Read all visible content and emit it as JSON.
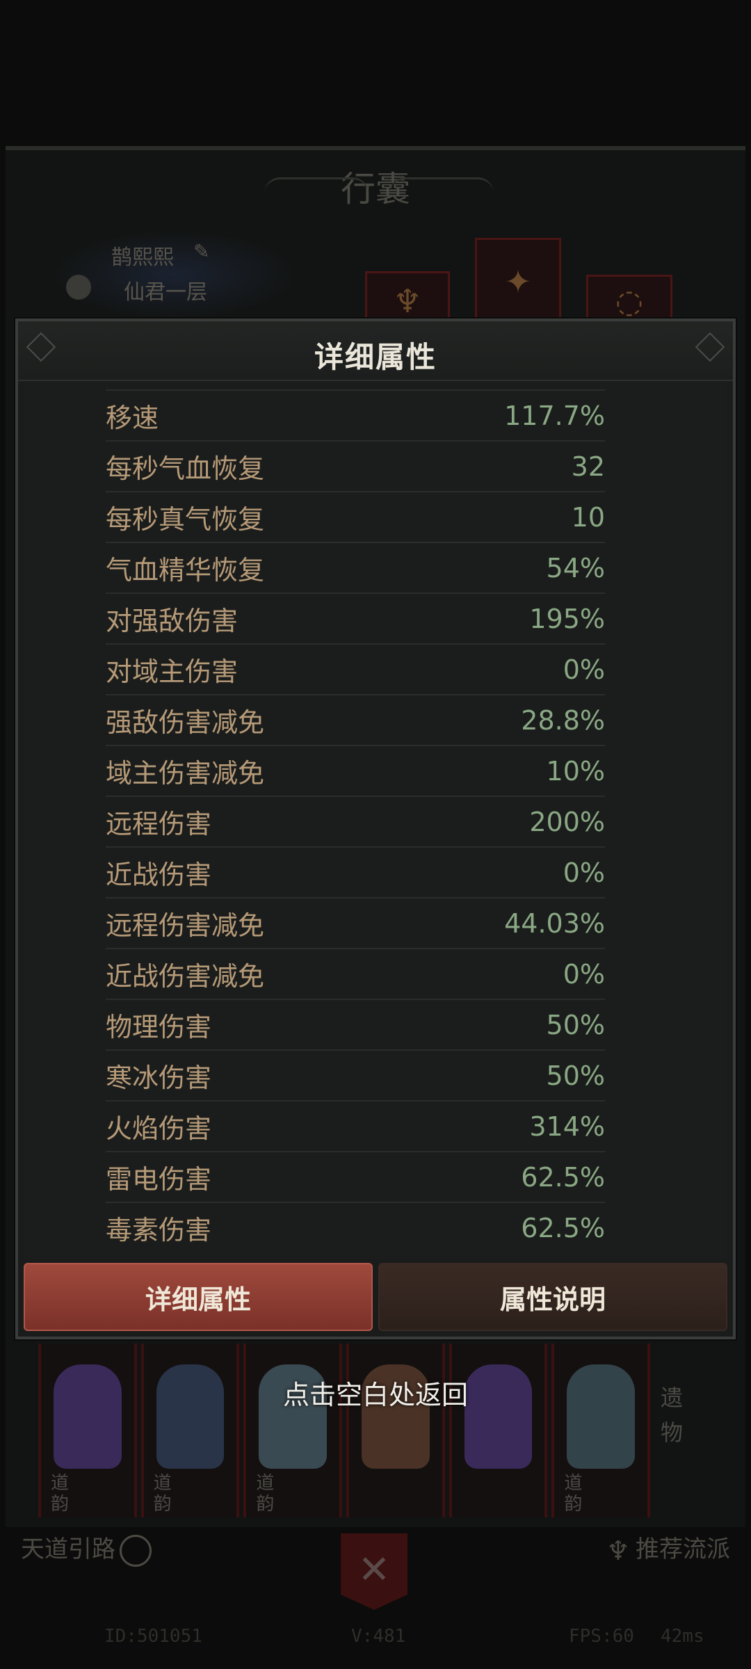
{
  "background": {
    "bag_title": "行囊",
    "player_name": "鹊熙熙",
    "player_rank": "仙君一层",
    "categories": [
      {
        "tag": "道韵",
        "color": "#3a2a5a"
      },
      {
        "tag": "道韵",
        "color": "#2a3448"
      },
      {
        "tag": "道韵",
        "color": "#3a4a52"
      },
      {
        "tag": "",
        "color": "#4a3226"
      },
      {
        "tag": "",
        "color": "#3a2a5a"
      },
      {
        "tag": "道韵",
        "color": "#33434a"
      }
    ],
    "relic_label": "遗物",
    "bottom_left": "天道引路",
    "bottom_right": "推荐流派",
    "status": {
      "id": "ID:501051",
      "version": "V:481",
      "fps": "FPS:60",
      "ping": "42ms"
    }
  },
  "popup": {
    "title": "详细属性",
    "stats": [
      {
        "name": "移速",
        "value": "117.7%"
      },
      {
        "name": "每秒气血恢复",
        "value": "32"
      },
      {
        "name": "每秒真气恢复",
        "value": "10"
      },
      {
        "name": "气血精华恢复",
        "value": "54%"
      },
      {
        "name": "对强敌伤害",
        "value": "195%"
      },
      {
        "name": "对域主伤害",
        "value": "0%"
      },
      {
        "name": "强敌伤害减免",
        "value": "28.8%"
      },
      {
        "name": "域主伤害减免",
        "value": "10%"
      },
      {
        "name": "远程伤害",
        "value": "200%"
      },
      {
        "name": "近战伤害",
        "value": "0%"
      },
      {
        "name": "远程伤害减免",
        "value": "44.03%"
      },
      {
        "name": "近战伤害减免",
        "value": "0%"
      },
      {
        "name": "物理伤害",
        "value": "50%"
      },
      {
        "name": "寒冰伤害",
        "value": "50%"
      },
      {
        "name": "火焰伤害",
        "value": "314%"
      },
      {
        "name": "雷电伤害",
        "value": "62.5%"
      },
      {
        "name": "毒素伤害",
        "value": "62.5%"
      }
    ],
    "tabs": [
      {
        "label": "详细属性",
        "active": true
      },
      {
        "label": "属性说明",
        "active": false
      }
    ]
  },
  "return_hint": "点击空白处返回",
  "colors": {
    "stat_name": "#b69a78",
    "stat_value": "#8aa884",
    "tab_active": "#a0493d"
  }
}
